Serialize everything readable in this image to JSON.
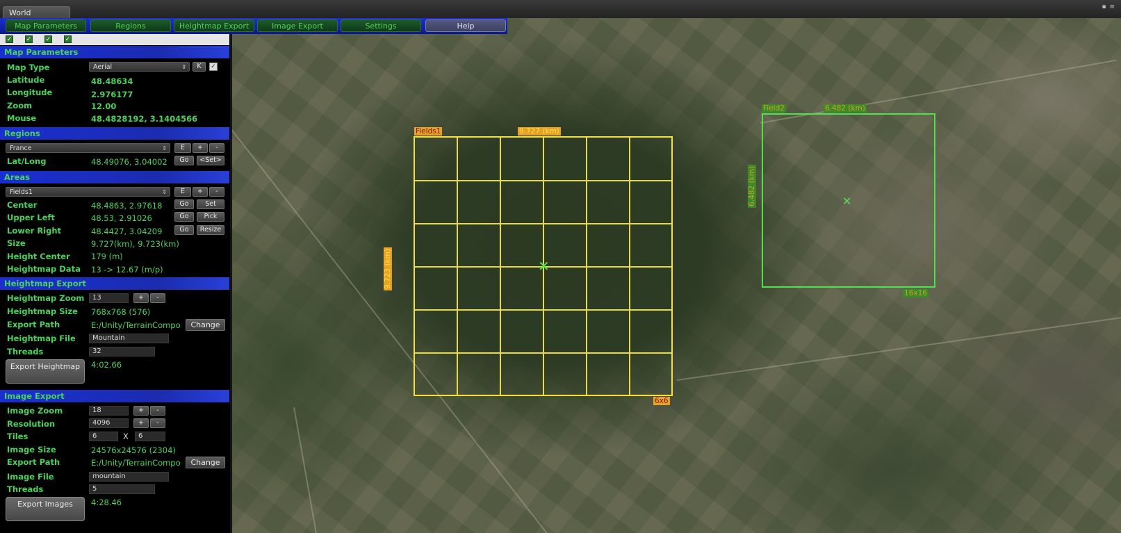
{
  "window": {
    "title": "World"
  },
  "tabs": [
    {
      "label": "Map Parameters"
    },
    {
      "label": "Regions"
    },
    {
      "label": "Heightmap Export"
    },
    {
      "label": "Image Export"
    },
    {
      "label": "Settings"
    },
    {
      "label": "Help"
    }
  ],
  "map_parameters": {
    "header": "Map Parameters",
    "map_type_label": "Map Type",
    "map_type_value": "Aerial",
    "k_button": "K",
    "latitude_label": "Latitude",
    "latitude": "48.48634",
    "longitude_label": "Longitude",
    "longitude": "2.976177",
    "zoom_label": "Zoom",
    "zoom": "12.00",
    "mouse_label": "Mouse",
    "mouse": "48.4828192, 3.1404566"
  },
  "regions": {
    "header": "Regions",
    "selected": "France",
    "e_button": "E",
    "plus_button": "+",
    "minus_button": "-",
    "latlong_label": "Lat/Long",
    "latlong": "48.49076, 3.04002",
    "go_button": "Go",
    "set_button": "<Set>"
  },
  "areas": {
    "header": "Areas",
    "selected": "Fields1",
    "e_button": "E",
    "plus_button": "+",
    "minus_button": "-",
    "center_label": "Center",
    "center": "48.4863, 2.97618",
    "upper_left_label": "Upper Left",
    "upper_left": "48.53, 2.91026",
    "lower_right_label": "Lower Right",
    "lower_right": "48.4427, 3.04209",
    "size_label": "Size",
    "size": "9.727(km), 9.723(km)",
    "height_center_label": "Height Center",
    "height_center": "179 (m)",
    "heightmap_data_label": "Heightmap Data",
    "heightmap_data": "13 -> 12.67 (m/p)",
    "go_label": "Go",
    "set_label": "Set",
    "pick_label": "Pick",
    "resize_label": "Resize"
  },
  "heightmap_export": {
    "header": "Heightmap Export",
    "zoom_label": "Heightmap Zoom",
    "zoom": "13",
    "size_label": "Heightmap Size",
    "size": "768x768  (576)",
    "export_path_label": "Export Path",
    "export_path": "E:/Unity/TerrainCompo",
    "change_button": "Change",
    "file_label": "Heightmap File",
    "file": "Mountain",
    "threads_label": "Threads",
    "threads": "32",
    "export_button": "Export Heightmap",
    "time": "4:02.66",
    "plus": "+",
    "minus": "-"
  },
  "image_export": {
    "header": "Image Export",
    "zoom_label": "Image Zoom",
    "zoom": "18",
    "resolution_label": "Resolution",
    "resolution": "4096",
    "tiles_label": "Tiles",
    "tiles_x": "6",
    "tiles_sep": "X",
    "tiles_y": "6",
    "size_label": "Image Size",
    "size": "24576x24576  (2304)",
    "export_path_label": "Export Path",
    "export_path": "E:/Unity/TerrainCompo",
    "change_button": "Change",
    "file_label": "Image File",
    "file": "mountain",
    "threads_label": "Threads",
    "threads": "5",
    "export_button": "Export Images",
    "time": "4:28.46",
    "plus": "+",
    "minus": "-"
  },
  "overlay": {
    "fields1": {
      "name": "Fields1",
      "width_km": "9.727 (km)",
      "height_km": "9.723 (km)",
      "tiles": "6x6",
      "color": "#f2e23a"
    },
    "field2": {
      "name": "Field2",
      "width_km": "6.482 (km)",
      "height_km": "6.482 (km)",
      "tiles": "16x16",
      "color": "#52e052"
    }
  }
}
